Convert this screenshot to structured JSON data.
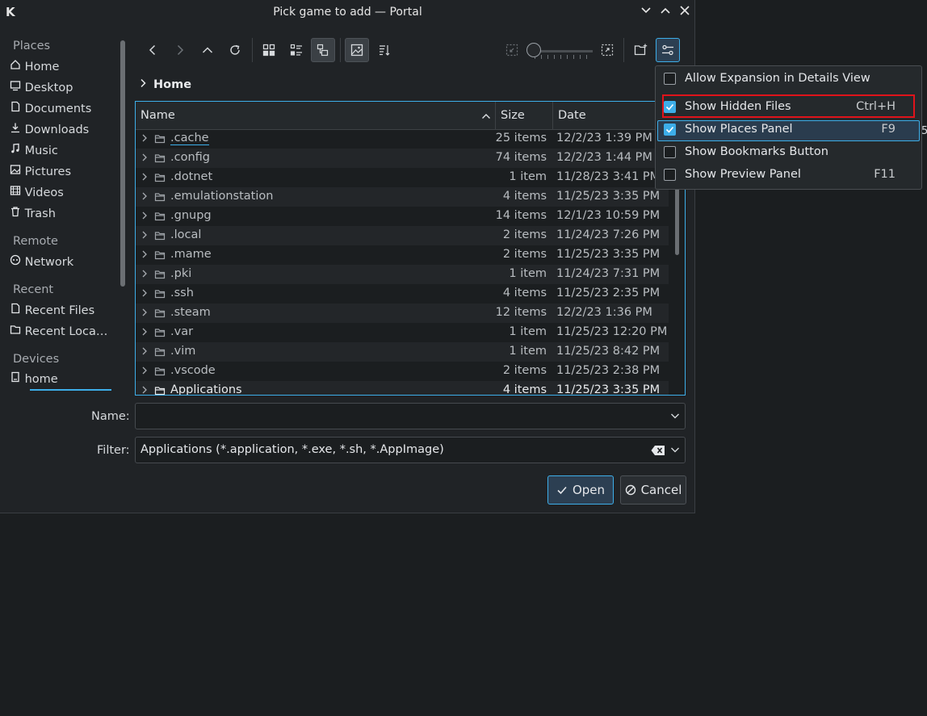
{
  "window": {
    "title": "Pick game to add — Portal",
    "logo": "K",
    "controls": [
      "chevron-down-icon",
      "chevron-up-icon",
      "close-icon"
    ]
  },
  "sidebar": {
    "places_header": "Places",
    "places": [
      {
        "label": "Home",
        "icon": "home-icon",
        "selected": true
      },
      {
        "label": "Desktop",
        "icon": "desktop-icon"
      },
      {
        "label": "Documents",
        "icon": "documents-icon"
      },
      {
        "label": "Downloads",
        "icon": "downloads-icon"
      },
      {
        "label": "Music",
        "icon": "music-icon"
      },
      {
        "label": "Pictures",
        "icon": "pictures-icon"
      },
      {
        "label": "Videos",
        "icon": "videos-icon"
      },
      {
        "label": "Trash",
        "icon": "trash-icon"
      }
    ],
    "remote_header": "Remote",
    "remote": [
      {
        "label": "Network",
        "icon": "network-icon"
      }
    ],
    "recent_header": "Recent",
    "recent": [
      {
        "label": "Recent Files",
        "icon": "recent-files-icon"
      },
      {
        "label": "Recent Loca…",
        "icon": "recent-locations-icon"
      }
    ],
    "devices_header": "Devices",
    "devices": [
      {
        "label": "home",
        "icon": "drive-icon"
      }
    ]
  },
  "toolbar": {
    "buttons": [
      "back-icon",
      "forward-icon",
      "up-icon",
      "reload-icon",
      "icons-view-icon",
      "compact-view-icon",
      "details-view-icon",
      "preview-icon",
      "sort-icon",
      "zoom-out-icon",
      "zoom-in-icon",
      "new-folder-icon",
      "options-icon"
    ]
  },
  "breadcrumb": {
    "current": "Home"
  },
  "table": {
    "columns": [
      "Name",
      "Size",
      "Date"
    ],
    "rows": [
      {
        "name": ".cache",
        "size": "25 items",
        "date": "12/2/23 1:39 PM"
      },
      {
        "name": ".config",
        "size": "74 items",
        "date": "12/2/23 1:44 PM"
      },
      {
        "name": ".dotnet",
        "size": "1 item",
        "date": "11/28/23 3:41 PM"
      },
      {
        "name": ".emulationstation",
        "size": "4 items",
        "date": "11/25/23 3:35 PM"
      },
      {
        "name": ".gnupg",
        "size": "14 items",
        "date": "12/1/23 10:59 PM"
      },
      {
        "name": ".local",
        "size": "2 items",
        "date": "11/24/23 7:26 PM"
      },
      {
        "name": ".mame",
        "size": "2 items",
        "date": "11/25/23 3:35 PM"
      },
      {
        "name": ".pki",
        "size": "1 item",
        "date": "11/24/23 7:31 PM"
      },
      {
        "name": ".ssh",
        "size": "4 items",
        "date": "11/25/23 2:35 PM"
      },
      {
        "name": ".steam",
        "size": "12 items",
        "date": "12/2/23 1:36 PM"
      },
      {
        "name": ".var",
        "size": "1 item",
        "date": "11/25/23 12:20 PM"
      },
      {
        "name": ".vim",
        "size": "1 item",
        "date": "11/25/23 8:42 PM"
      },
      {
        "name": ".vscode",
        "size": "2 items",
        "date": "11/25/23 2:38 PM"
      },
      {
        "name": "Applications",
        "size": "4 items",
        "date": "11/25/23 3:35 PM"
      }
    ]
  },
  "form": {
    "name_label": "Name:",
    "name_value": "",
    "filter_label": "Filter:",
    "filter_value": "Applications (*.application, *.exe, *.sh, *.AppImage)"
  },
  "buttons": {
    "open": "Open",
    "cancel": "Cancel"
  },
  "options_menu": {
    "items": [
      {
        "label": "Allow Expansion in Details View",
        "checked": false,
        "shortcut": ""
      },
      {
        "label": "Show Hidden Files",
        "checked": true,
        "shortcut": "Ctrl+H"
      },
      {
        "label": "Show Places Panel",
        "checked": true,
        "shortcut": "F9"
      },
      {
        "label": "Show Bookmarks Button",
        "checked": false,
        "shortcut": ""
      },
      {
        "label": "Show Preview Panel",
        "checked": false,
        "shortcut": "F11"
      }
    ]
  },
  "colors": {
    "accent": "#3daee9",
    "highlight_box": "#e0131b",
    "background": "#202326"
  }
}
